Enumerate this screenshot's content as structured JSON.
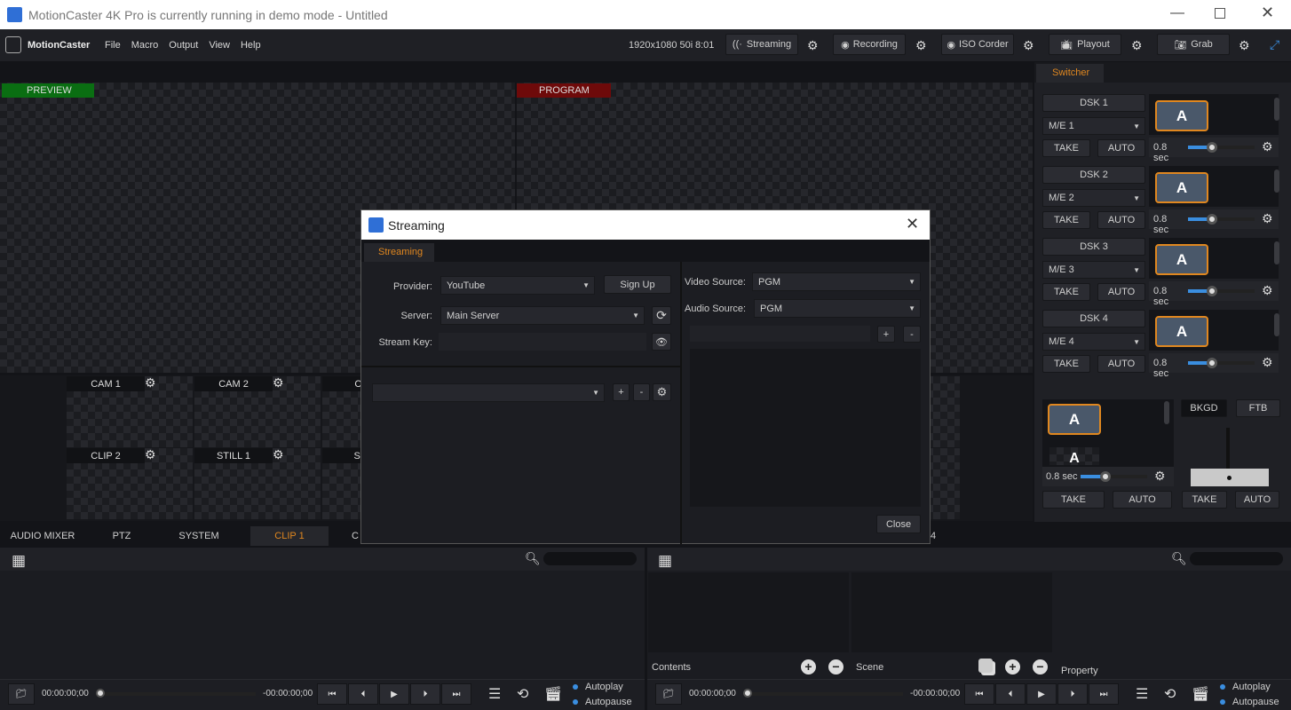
{
  "window": {
    "title": "MotionCaster 4K Pro is currently running in demo mode - Untitled",
    "controls": [
      "minimize",
      "maximize",
      "close"
    ]
  },
  "menubar": {
    "app_name": "MotionCaster",
    "menu": [
      "File",
      "Macro",
      "Output",
      "View",
      "Help"
    ],
    "format": "1920x1080 50i",
    "time": "8:01",
    "buttons": [
      {
        "label": "Streaming",
        "icon": "streaming-icon"
      },
      {
        "label": "Recording",
        "icon": "record-icon"
      },
      {
        "label": "ISO Corder",
        "icon": "record-icon"
      },
      {
        "label": "Playout",
        "icon": "tv-icon"
      },
      {
        "label": "Grab",
        "icon": "camera-icon"
      }
    ]
  },
  "monitors": {
    "preview_label": "PREVIEW",
    "program_label": "PROGRAM",
    "preview_color": "#0a6e12",
    "program_color": "#6e0a0a"
  },
  "multiview": {
    "row1": [
      "CAM 1",
      "CAM 2",
      "CA"
    ],
    "row2": [
      "CLIP 2",
      "STILL 1",
      "STI"
    ]
  },
  "switcher": {
    "tab": "Switcher",
    "dsk": [
      {
        "label": "DSK 1",
        "me": "M/E 1"
      },
      {
        "label": "DSK 2",
        "me": "M/E 2"
      },
      {
        "label": "DSK 3",
        "me": "M/E 3"
      },
      {
        "label": "DSK 4",
        "me": "M/E 4"
      }
    ],
    "take": "TAKE",
    "auto": "AUTO",
    "duration": "0.8 sec",
    "duration_fraction": 0.35,
    "source_label": "A",
    "bkgd": "BKGD",
    "ftb": "FTB",
    "accent": "#e0871f"
  },
  "bottom_tabs": [
    "AUDIO MIXER",
    "PTZ",
    "SYSTEM",
    "CLIP 1",
    "C",
    "4"
  ],
  "bottom_tabs_active": "CLIP 1",
  "lower_right": {
    "contents": "Contents",
    "scene": "Scene",
    "property": "Property"
  },
  "transport": {
    "time_start": "00:00:00;00",
    "time_end": "-00:00:00;00",
    "autoplay": "Autoplay",
    "autopause": "Autopause"
  },
  "dialog": {
    "title": "Streaming",
    "tab": "Streaming",
    "provider_label": "Provider:",
    "provider_value": "YouTube",
    "signup": "Sign Up",
    "server_label": "Server:",
    "server_value": "Main Server",
    "stream_key_label": "Stream Key:",
    "stream_key_value": "",
    "video_source_label": "Video Source:",
    "video_source_value": "PGM",
    "audio_source_label": "Audio Source:",
    "audio_source_value": "PGM",
    "plus": "+",
    "minus": "-",
    "close": "Close"
  }
}
